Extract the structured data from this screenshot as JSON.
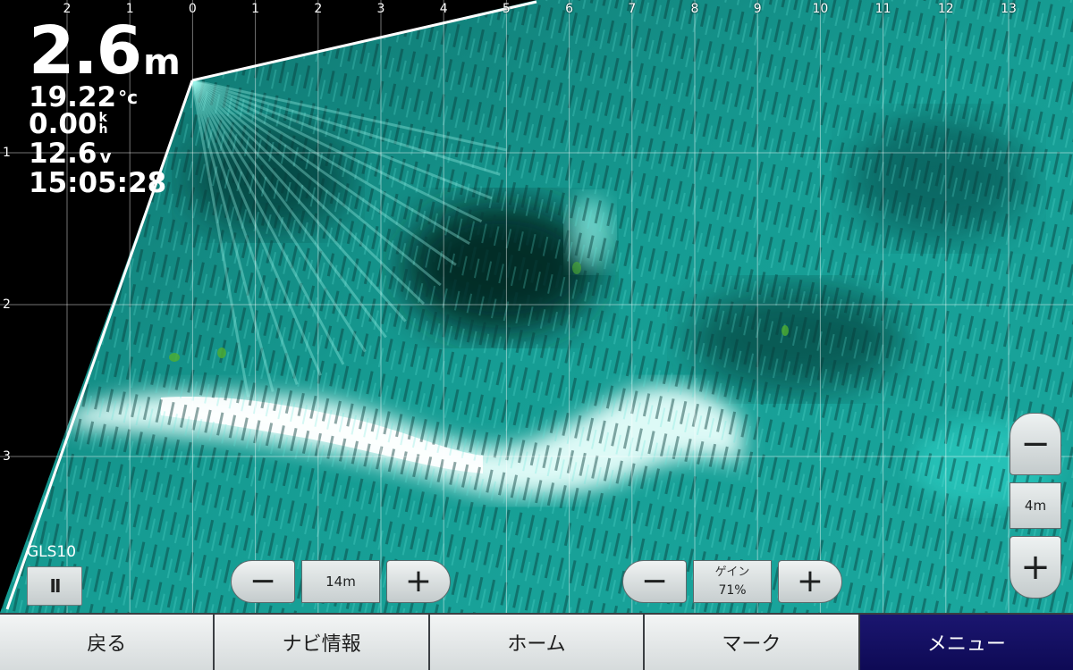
{
  "x_axis": {
    "labels": [
      "2",
      "1",
      "0",
      "1",
      "2",
      "3",
      "4",
      "5",
      "6",
      "7",
      "8",
      "9",
      "10",
      "11",
      "12",
      "13"
    ]
  },
  "y_axis": {
    "labels": [
      "1",
      "2",
      "3"
    ]
  },
  "readouts": {
    "depth_value": "2.6",
    "depth_unit": "m",
    "water_temp_value": "19.22",
    "water_temp_unit": "°c",
    "speed_value": "0.00",
    "speed_unit_top": "k",
    "speed_unit_bottom": "h",
    "voltage_value": "12.6",
    "voltage_unit": "v",
    "time": "15:05:28"
  },
  "source": {
    "label": "GLS10",
    "pause_glyph": "II"
  },
  "range_control": {
    "minus": "−",
    "value": "14m",
    "plus": "+"
  },
  "gain_control": {
    "minus": "−",
    "label": "ゲイン",
    "value": "71%",
    "plus": "+"
  },
  "zoom_control": {
    "minus": "−",
    "value": "4m",
    "plus": "+"
  },
  "bottom_nav": [
    {
      "label": "戻る",
      "active": false
    },
    {
      "label": "ナビ情報",
      "active": false
    },
    {
      "label": "ホーム",
      "active": false
    },
    {
      "label": "マーク",
      "active": false
    },
    {
      "label": "メニュー",
      "active": true
    }
  ],
  "colors": {
    "sonar_teal": "#1fb3aa",
    "sonar_bright": "#e8fffc",
    "nav_active": "#12105e"
  }
}
